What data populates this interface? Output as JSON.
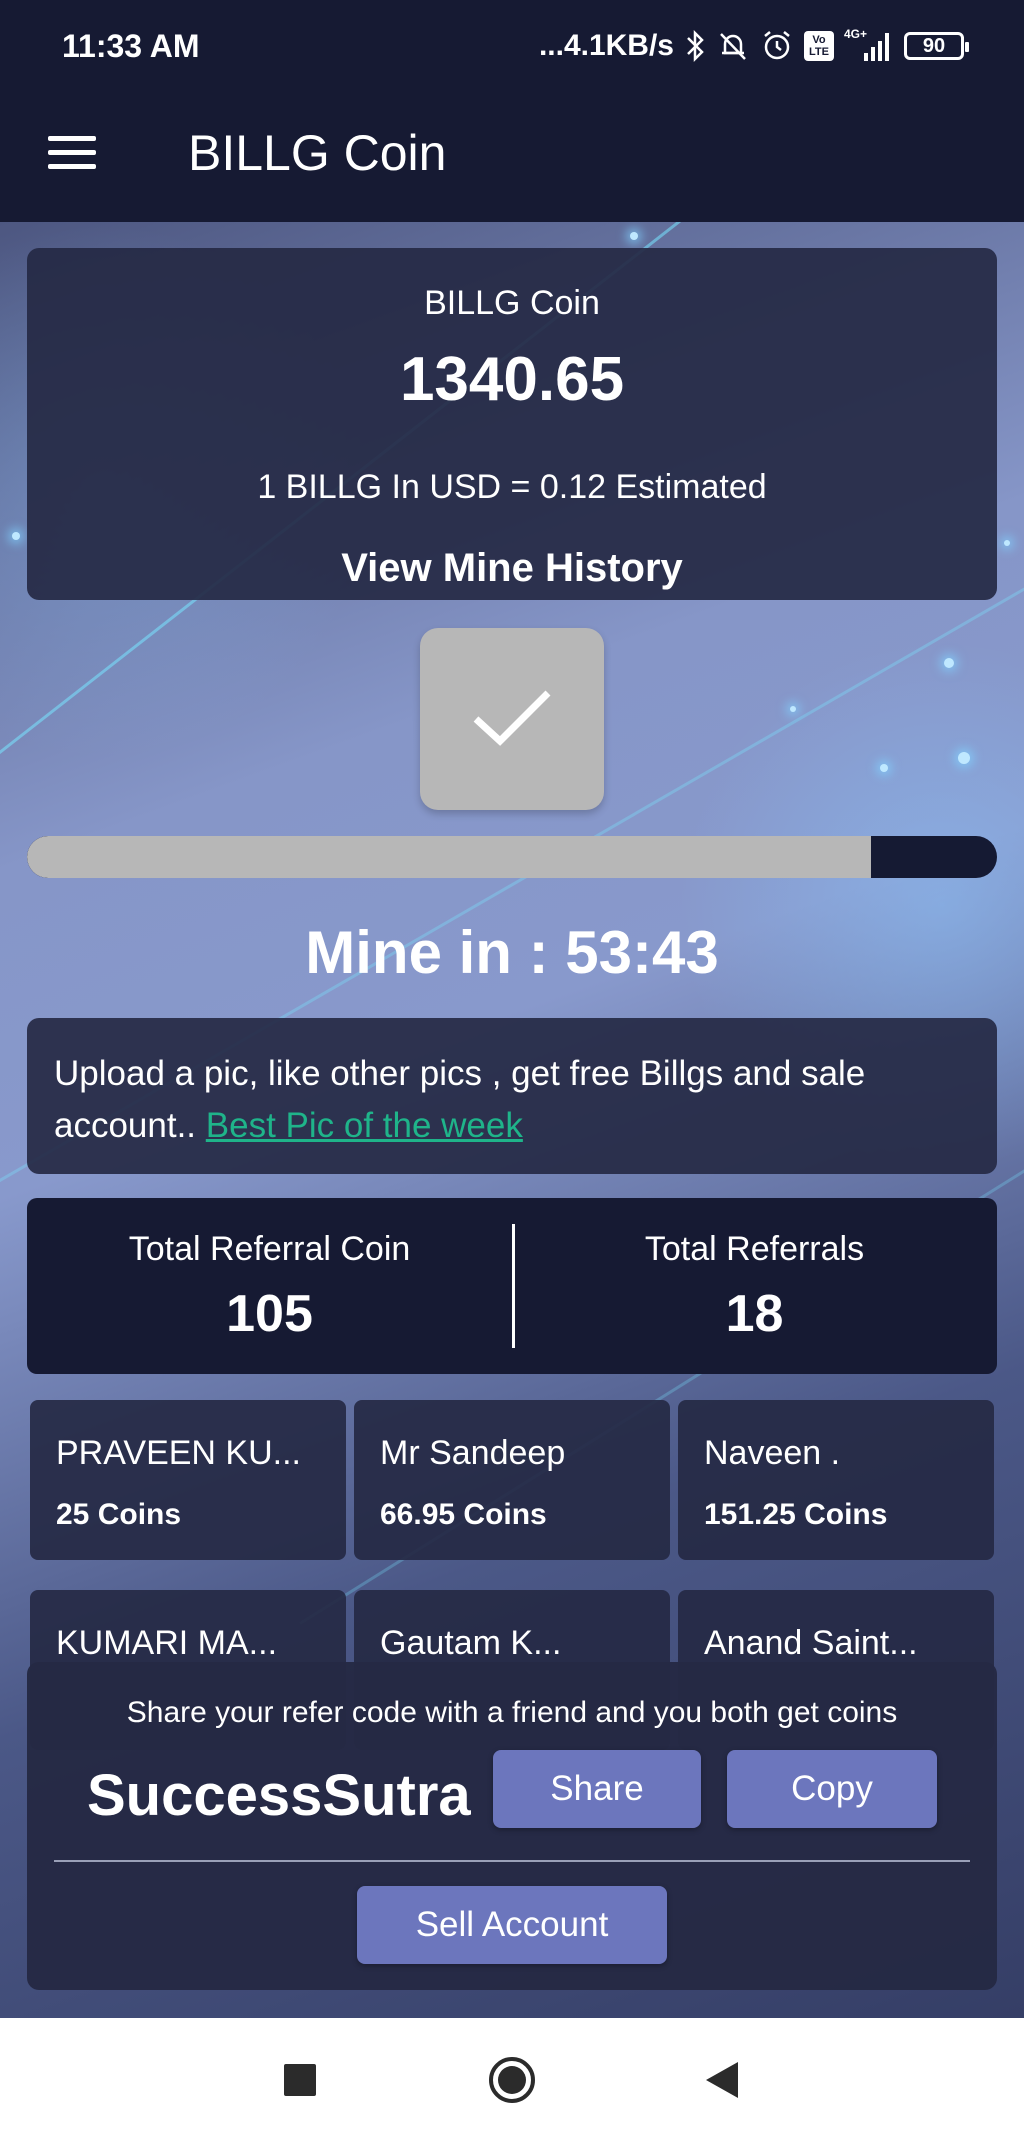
{
  "status_bar": {
    "time": "11:33 AM",
    "speed": "...4.1KB/s",
    "network_label": "4G+",
    "volte_label": "Vo LTE",
    "battery": "90"
  },
  "app_bar": {
    "title": "BILLG Coin"
  },
  "coin_card": {
    "label": "BILLG Coin",
    "amount": "1340.65",
    "rate": "1 BILLG In USD = 0.12 Estimated",
    "history_link": "View Mine History"
  },
  "mining": {
    "progress_fraction": 0.87,
    "timer": "Mine in : 53:43"
  },
  "upload": {
    "text": "Upload a pic, like other pics , get free Billgs and sale account.. ",
    "link": "Best Pic of the week "
  },
  "referrals": {
    "coin_label": "Total Referral Coin",
    "coin_value": "105",
    "count_label": "Total Referrals",
    "count_value": "18"
  },
  "users": [
    {
      "name": "PRAVEEN KU...",
      "coins": "25 Coins"
    },
    {
      "name": "Mr Sandeep",
      "coins": "66.95 Coins"
    },
    {
      "name": "Naveen .",
      "coins": "151.25 Coins"
    },
    {
      "name": "KUMARI MA...",
      "coins": ""
    },
    {
      "name": "Gautam K...",
      "coins": ""
    },
    {
      "name": "Anand Saint...",
      "coins": ""
    }
  ],
  "share": {
    "text": "Share your refer code with a friend and you both get coins",
    "code": "SuccessSutra",
    "share_label": "Share",
    "copy_label": "Copy",
    "sell_label": "Sell Account"
  },
  "colors": {
    "dark_navy": "#161a33",
    "card_bg": "#252944",
    "button": "#6c76bd",
    "link": "#1fb48a",
    "check_button": "#b7b7b7"
  }
}
